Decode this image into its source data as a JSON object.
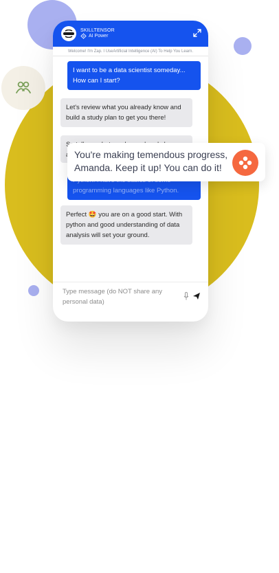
{
  "header": {
    "brand_name": "SKILLTENSOR",
    "brand_sub": "AI Power",
    "welcome": "Welcome! I'm Zap. I UseArtificial Intelligence (AI) To Help You Learn."
  },
  "messages": [
    {
      "role": "user",
      "text": "I want to be a data scientist someday... How can I start?"
    },
    {
      "role": "bot",
      "text": "Let's review what you already know and build a study plan to get you there!"
    },
    {
      "role": "bot",
      "text": "So tell me what you have already know about..."
    },
    {
      "role": "user",
      "text": "Python. I have the basics of some programming languages like Python."
    },
    {
      "role": "bot",
      "text": "Perfect 🤩 you are on a good start. With python and good understanding of data analysis will set your ground."
    }
  ],
  "input": {
    "placeholder": "Type message (do NOT share any personal data)"
  },
  "toast": {
    "text": "You're making temendous progress, Amanda. Keep it up! You can do it!"
  },
  "colors": {
    "primary": "#1553ee",
    "accent_yellow": "#d9bd1e",
    "accent_purple": "#a9b0f0",
    "toast_icon": "#f5683f",
    "bot_bubble": "#e9e9ec"
  },
  "icons": [
    "users-icon",
    "skilltensor-logo-icon",
    "gear-icon",
    "expand-icon",
    "mic-icon",
    "send-icon",
    "sparkle-icon"
  ]
}
